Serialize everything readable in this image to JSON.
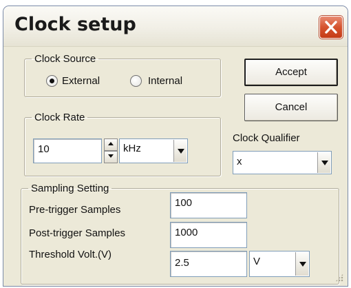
{
  "window": {
    "title": "Clock setup",
    "close_icon": "close-icon"
  },
  "clock_source": {
    "legend": "Clock Source",
    "options": [
      {
        "label": "External",
        "selected": true
      },
      {
        "label": "Internal",
        "selected": false
      }
    ]
  },
  "buttons": {
    "accept": "Accept",
    "cancel": "Cancel"
  },
  "clock_rate": {
    "legend": "Clock Rate",
    "value": "10",
    "unit": "kHz"
  },
  "clock_qualifier": {
    "label": "Clock Qualifier",
    "value": "x"
  },
  "sampling": {
    "legend": "Sampling Setting",
    "pretrigger_label": "Pre-trigger Samples",
    "pretrigger_value": "100",
    "posttrigger_label": "Post-trigger Samples",
    "posttrigger_value": "1000",
    "threshold_label": "Threshold Volt.(V)",
    "threshold_value": "2.5",
    "threshold_unit": "V"
  },
  "colors": {
    "dialog_bg": "#ece9d8",
    "close_button": "#d5532f",
    "field_border": "#7f9db9"
  }
}
